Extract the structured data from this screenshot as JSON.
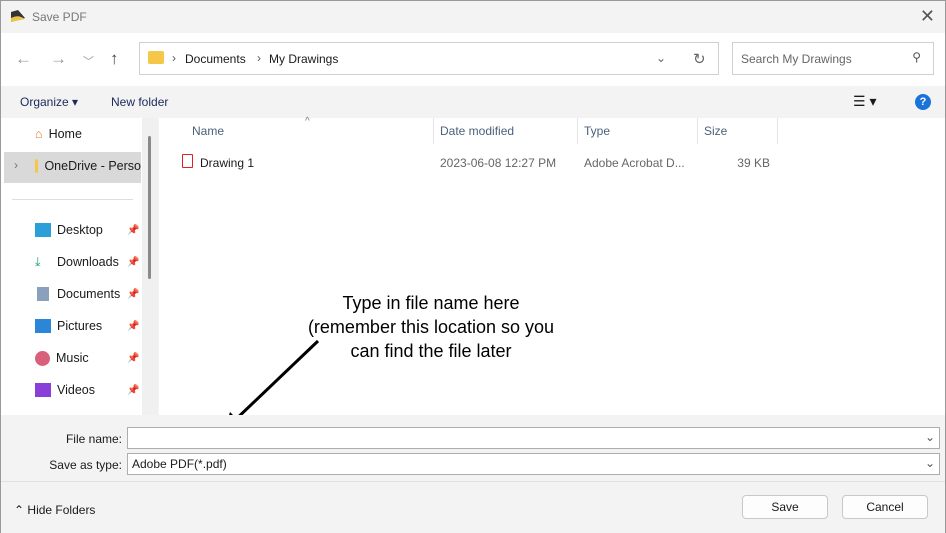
{
  "title": "Save PDF",
  "breadcrumb": [
    "Documents",
    "My Drawings"
  ],
  "search_placeholder": "Search My Drawings",
  "toolbar": {
    "organize": "Organize",
    "new_folder": "New folder"
  },
  "sidebar": {
    "items": [
      {
        "label": "Home"
      },
      {
        "label": "OneDrive - Perso"
      },
      {
        "label": "Desktop"
      },
      {
        "label": "Downloads"
      },
      {
        "label": "Documents"
      },
      {
        "label": "Pictures"
      },
      {
        "label": "Music"
      },
      {
        "label": "Videos"
      }
    ]
  },
  "columns": [
    "Name",
    "Date modified",
    "Type",
    "Size"
  ],
  "files": [
    {
      "name": "Drawing 1",
      "date": "2023-06-08 12:27 PM",
      "type": "Adobe Acrobat D...",
      "size": "39 KB"
    }
  ],
  "annotation": "Type in file name here (remember this location so you can find the file later",
  "form": {
    "file_name_label": "File name:",
    "file_name_value": "",
    "save_type_label": "Save as type:",
    "save_type_value": "Adobe PDF(*.pdf)"
  },
  "footer": {
    "hide_folders": "Hide Folders",
    "save": "Save",
    "cancel": "Cancel"
  }
}
